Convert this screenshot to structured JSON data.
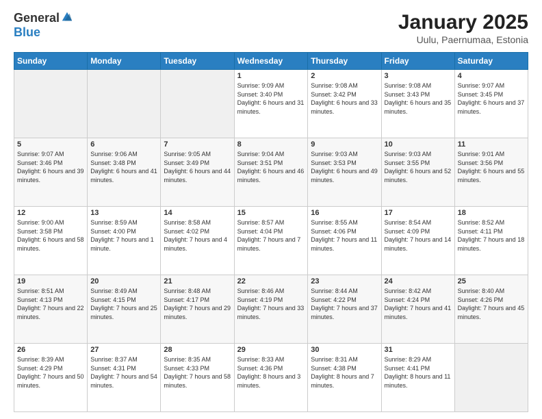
{
  "logo": {
    "general": "General",
    "blue": "Blue"
  },
  "header": {
    "month": "January 2025",
    "location": "Uulu, Paernumaa, Estonia"
  },
  "weekdays": [
    "Sunday",
    "Monday",
    "Tuesday",
    "Wednesday",
    "Thursday",
    "Friday",
    "Saturday"
  ],
  "weeks": [
    [
      {
        "day": "",
        "info": ""
      },
      {
        "day": "",
        "info": ""
      },
      {
        "day": "",
        "info": ""
      },
      {
        "day": "1",
        "info": "Sunrise: 9:09 AM\nSunset: 3:40 PM\nDaylight: 6 hours and 31 minutes."
      },
      {
        "day": "2",
        "info": "Sunrise: 9:08 AM\nSunset: 3:42 PM\nDaylight: 6 hours and 33 minutes."
      },
      {
        "day": "3",
        "info": "Sunrise: 9:08 AM\nSunset: 3:43 PM\nDaylight: 6 hours and 35 minutes."
      },
      {
        "day": "4",
        "info": "Sunrise: 9:07 AM\nSunset: 3:45 PM\nDaylight: 6 hours and 37 minutes."
      }
    ],
    [
      {
        "day": "5",
        "info": "Sunrise: 9:07 AM\nSunset: 3:46 PM\nDaylight: 6 hours and 39 minutes."
      },
      {
        "day": "6",
        "info": "Sunrise: 9:06 AM\nSunset: 3:48 PM\nDaylight: 6 hours and 41 minutes."
      },
      {
        "day": "7",
        "info": "Sunrise: 9:05 AM\nSunset: 3:49 PM\nDaylight: 6 hours and 44 minutes."
      },
      {
        "day": "8",
        "info": "Sunrise: 9:04 AM\nSunset: 3:51 PM\nDaylight: 6 hours and 46 minutes."
      },
      {
        "day": "9",
        "info": "Sunrise: 9:03 AM\nSunset: 3:53 PM\nDaylight: 6 hours and 49 minutes."
      },
      {
        "day": "10",
        "info": "Sunrise: 9:03 AM\nSunset: 3:55 PM\nDaylight: 6 hours and 52 minutes."
      },
      {
        "day": "11",
        "info": "Sunrise: 9:01 AM\nSunset: 3:56 PM\nDaylight: 6 hours and 55 minutes."
      }
    ],
    [
      {
        "day": "12",
        "info": "Sunrise: 9:00 AM\nSunset: 3:58 PM\nDaylight: 6 hours and 58 minutes."
      },
      {
        "day": "13",
        "info": "Sunrise: 8:59 AM\nSunset: 4:00 PM\nDaylight: 7 hours and 1 minute."
      },
      {
        "day": "14",
        "info": "Sunrise: 8:58 AM\nSunset: 4:02 PM\nDaylight: 7 hours and 4 minutes."
      },
      {
        "day": "15",
        "info": "Sunrise: 8:57 AM\nSunset: 4:04 PM\nDaylight: 7 hours and 7 minutes."
      },
      {
        "day": "16",
        "info": "Sunrise: 8:55 AM\nSunset: 4:06 PM\nDaylight: 7 hours and 11 minutes."
      },
      {
        "day": "17",
        "info": "Sunrise: 8:54 AM\nSunset: 4:09 PM\nDaylight: 7 hours and 14 minutes."
      },
      {
        "day": "18",
        "info": "Sunrise: 8:52 AM\nSunset: 4:11 PM\nDaylight: 7 hours and 18 minutes."
      }
    ],
    [
      {
        "day": "19",
        "info": "Sunrise: 8:51 AM\nSunset: 4:13 PM\nDaylight: 7 hours and 22 minutes."
      },
      {
        "day": "20",
        "info": "Sunrise: 8:49 AM\nSunset: 4:15 PM\nDaylight: 7 hours and 25 minutes."
      },
      {
        "day": "21",
        "info": "Sunrise: 8:48 AM\nSunset: 4:17 PM\nDaylight: 7 hours and 29 minutes."
      },
      {
        "day": "22",
        "info": "Sunrise: 8:46 AM\nSunset: 4:19 PM\nDaylight: 7 hours and 33 minutes."
      },
      {
        "day": "23",
        "info": "Sunrise: 8:44 AM\nSunset: 4:22 PM\nDaylight: 7 hours and 37 minutes."
      },
      {
        "day": "24",
        "info": "Sunrise: 8:42 AM\nSunset: 4:24 PM\nDaylight: 7 hours and 41 minutes."
      },
      {
        "day": "25",
        "info": "Sunrise: 8:40 AM\nSunset: 4:26 PM\nDaylight: 7 hours and 45 minutes."
      }
    ],
    [
      {
        "day": "26",
        "info": "Sunrise: 8:39 AM\nSunset: 4:29 PM\nDaylight: 7 hours and 50 minutes."
      },
      {
        "day": "27",
        "info": "Sunrise: 8:37 AM\nSunset: 4:31 PM\nDaylight: 7 hours and 54 minutes."
      },
      {
        "day": "28",
        "info": "Sunrise: 8:35 AM\nSunset: 4:33 PM\nDaylight: 7 hours and 58 minutes."
      },
      {
        "day": "29",
        "info": "Sunrise: 8:33 AM\nSunset: 4:36 PM\nDaylight: 8 hours and 3 minutes."
      },
      {
        "day": "30",
        "info": "Sunrise: 8:31 AM\nSunset: 4:38 PM\nDaylight: 8 hours and 7 minutes."
      },
      {
        "day": "31",
        "info": "Sunrise: 8:29 AM\nSunset: 4:41 PM\nDaylight: 8 hours and 11 minutes."
      },
      {
        "day": "",
        "info": ""
      }
    ]
  ]
}
